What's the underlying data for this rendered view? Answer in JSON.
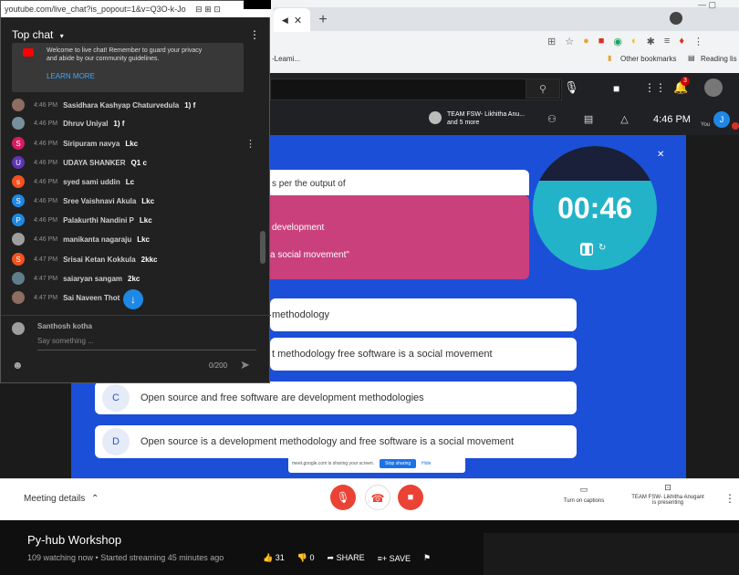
{
  "browser": {
    "tab_close": "✕",
    "new_tab": "+",
    "bookmark_partial": "-Leami...",
    "bookmarks": [
      "Other bookmarks",
      "Reading lis"
    ],
    "notif_count": "3"
  },
  "meet_top": {
    "presenter_line1": "TEAM FSW- Likhitha Anu...",
    "presenter_line2": "and 5 more",
    "clock": "4:46 PM",
    "you_label": "You",
    "avatar_letter": "J"
  },
  "quiz": {
    "question_lines": [
      "s per the output of",
      "development",
      "a social movement\""
    ],
    "timer": "00:46",
    "options": [
      {
        "letter": "",
        "text": "methodology"
      },
      {
        "letter": "",
        "text": "t methodology free software is a social movement"
      },
      {
        "letter": "C",
        "text": "Open source and free software are development methodologies"
      },
      {
        "letter": "D",
        "text": "Open source is a development methodology and free software is a social movement"
      }
    ],
    "sharing_notice": "meet.google.com is sharing your screen.",
    "stop_sharing": "Stop sharing",
    "hide": "Hide"
  },
  "meet_bottom": {
    "meeting_details": "Meeting details",
    "captions": "Turn on captions",
    "presenting_line1": "TEAM FSW- Likhitha Anugant",
    "presenting_line2": "is presenting"
  },
  "video": {
    "title": "Py-hub Workshop",
    "meta": "109 watching now • Started streaming 45 minutes ago",
    "likes": "31",
    "dislikes": "0",
    "share": "SHARE",
    "save": "SAVE"
  },
  "chat": {
    "url": "youtube.com/live_chat?is_popout=1&v=Q3O-k-Jo",
    "header": "Top chat",
    "notice_lines": [
      "Welcome to live chat! Remember to guard your privacy",
      "and abide by our community guidelines."
    ],
    "learn_more": "LEARN MORE",
    "messages": [
      {
        "time": "4:46 PM",
        "author": "Sasidhara Kashyap Chaturvedula",
        "text": "1) f",
        "initial": "",
        "color": "#8d6e63"
      },
      {
        "time": "4:46 PM",
        "author": "Dhruv Uniyal",
        "text": "1) f",
        "initial": "",
        "color": "#78909c"
      },
      {
        "time": "4:46 PM",
        "author": "Siripuram navya",
        "text": "Lkc",
        "initial": "S",
        "color": "#d81b60"
      },
      {
        "time": "4:46 PM",
        "author": "UDAYA SHANKER",
        "text": "Q1 c",
        "initial": "U",
        "color": "#5e35b1"
      },
      {
        "time": "4:46 PM",
        "author": "syed sami uddin",
        "text": "Lc",
        "initial": "s",
        "color": "#f4511e"
      },
      {
        "time": "4:46 PM",
        "author": "Sree Vaishnavi Akula",
        "text": "Lkc",
        "initial": "S",
        "color": "#1e88e5"
      },
      {
        "time": "4:46 PM",
        "author": "Palakurthi Nandini P",
        "text": "Lkc",
        "initial": "P",
        "color": "#1e88e5"
      },
      {
        "time": "4:46 PM",
        "author": "manikanta nagaraju",
        "text": "Lkc",
        "initial": "",
        "color": "#9e9e9e"
      },
      {
        "time": "4:47 PM",
        "author": "Srisai Ketan Kokkula",
        "text": "2kkc",
        "initial": "S",
        "color": "#f4511e"
      },
      {
        "time": "4:47 PM",
        "author": "saiaryan sangam",
        "text": "2kc",
        "initial": "",
        "color": "#607d8b"
      },
      {
        "time": "4:47 PM",
        "author": "Sai Naveen Thot",
        "text": "i",
        "initial": "",
        "color": "#8d6e63"
      }
    ],
    "composer_name": "Santhosh kotha",
    "composer_placeholder": "Say something ...",
    "counter": "0/200"
  }
}
